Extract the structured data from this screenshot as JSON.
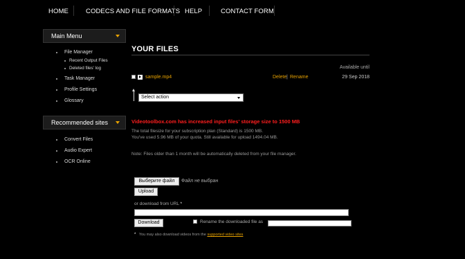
{
  "nav": {
    "items": [
      "HOME",
      "CODECS AND FILE FORMATS",
      "HELP",
      "CONTACT FORM"
    ]
  },
  "sidebar": {
    "main_menu": {
      "title": "Main Menu",
      "items": [
        {
          "label": "File Manager",
          "sub": false
        },
        {
          "label": "Recent Output Files",
          "sub": true
        },
        {
          "label": "Deleted files' log",
          "sub": true
        },
        {
          "label": "Task Manager",
          "sub": false
        },
        {
          "label": "Profile Settings",
          "sub": false
        },
        {
          "label": "Glossary",
          "sub": false
        }
      ]
    },
    "recommended": {
      "title": "Recommended sites",
      "items": [
        "Convert Files",
        "Audio Expert",
        "OCR Online"
      ]
    }
  },
  "main": {
    "heading": "YOUR FILES",
    "available_until_label": "Available until",
    "file": {
      "name": "sample.mp4",
      "delete_label": "Delete",
      "separator": "|",
      "rename_label": "Rename",
      "date": "29 Sep 2018"
    },
    "action_select": {
      "value": "Select action"
    },
    "notice": "Videotoolbox.com has increased input files' storage size to 1500 MB",
    "quota_line1": "The total filesize for your subscription plan (Standard) is 1500 MB.",
    "quota_line2": "You've used 5.96 MB of your quota. Still available for upload 1494.04 MB.",
    "note": "Note: Files older than 1 month will be automatically deleted from your file manager."
  },
  "upload": {
    "choose_file_label": "Выберите файл",
    "no_file_label": "Файл не выбран",
    "upload_button": "Upload",
    "url_label": "or download from URL",
    "star": "*",
    "url_value": "",
    "download_button": "Download",
    "rename_label": "Rename the downloaded file as",
    "rename_value": "",
    "footnote_star": "*",
    "footnote_text": "You may also download videos from the",
    "footnote_link": "supported video sites"
  },
  "colors": {
    "accent": "#e8a200",
    "notice": "#ff1e1e",
    "background": "#000000"
  }
}
